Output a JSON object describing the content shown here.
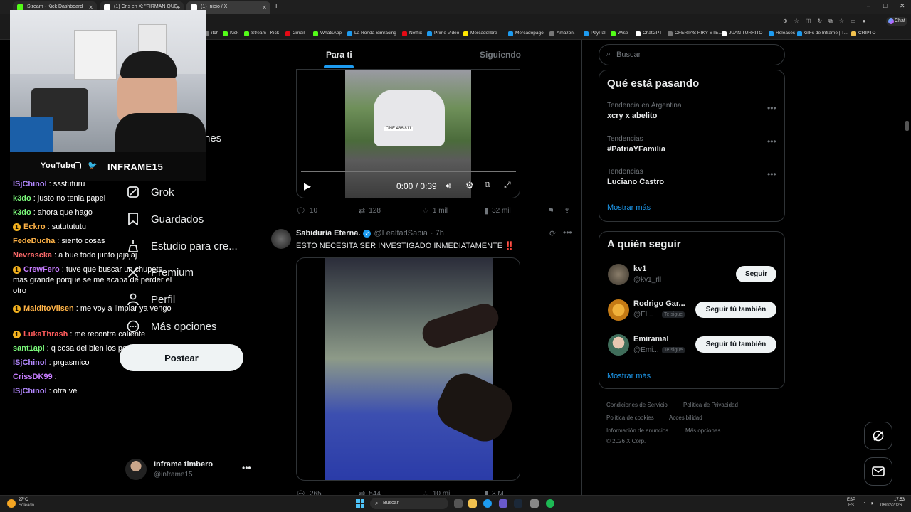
{
  "browser": {
    "tabs": [
      {
        "label": "Stream - Kick Dashboard"
      },
      {
        "label": "(1) Cris en X: \"FIRMAN QUE..."
      },
      {
        "label": "(1) Inicio / X"
      }
    ],
    "new_tab": "+",
    "window_controls": [
      "–",
      "□",
      "✕"
    ],
    "chat_label": "Chat",
    "bookmarks": [
      {
        "label": "itch",
        "cls": ""
      },
      {
        "label": "Kick",
        "cls": "kick"
      },
      {
        "label": "Stream - Kick",
        "cls": "kick"
      },
      {
        "label": "Gmail",
        "cls": "red"
      },
      {
        "label": "WhatsApp",
        "cls": "kick"
      },
      {
        "label": "La Ronda Simracing",
        "cls": "blue"
      },
      {
        "label": "Netflix",
        "cls": "red"
      },
      {
        "label": "Prime Video",
        "cls": "blue"
      },
      {
        "label": "Mercadolibre",
        "cls": "yel"
      },
      {
        "label": "Mercadopago",
        "cls": "blue"
      },
      {
        "label": "Amazon.",
        "cls": ""
      },
      {
        "label": "PayPal",
        "cls": "blue"
      },
      {
        "label": "Wise",
        "cls": "kick"
      },
      {
        "label": "ChatGPT",
        "cls": "x"
      },
      {
        "label": "OFERTAS RIKY STE...",
        "cls": ""
      },
      {
        "label": "JUAN TURRITO",
        "cls": "x"
      },
      {
        "label": "Releases",
        "cls": "blue"
      },
      {
        "label": "GIFs de Inframe | T...",
        "cls": "blue"
      },
      {
        "label": "CRIPTO",
        "cls": "folder"
      }
    ]
  },
  "stream_overlay": {
    "socials": [
      "YouTube",
      "INFRAME15"
    ],
    "chat": [
      {
        "user": "ISjChinol",
        "color": "#b388ff",
        "msg": ": ssstuturu",
        "badge": ""
      },
      {
        "user": "k3do",
        "color": "#7cfc7c",
        "msg": ": justo no tenia papel",
        "badge": ""
      },
      {
        "user": "k3do",
        "color": "#7cfc7c",
        "msg": ": ahora que hago",
        "badge": ""
      },
      {
        "user": "Eckro",
        "color": "#ffb347",
        "msg": ": sututututu",
        "badge": "1"
      },
      {
        "user": "FedeDucha",
        "color": "#ffb347",
        "msg": ": siento cosas",
        "badge": ""
      },
      {
        "user": "Nevrascka",
        "color": "#ff6b6b",
        "msg": ": a bue todo junto jajajaj",
        "badge": ""
      },
      {
        "user": "CrewFero",
        "color": "#c77dff",
        "msg": ": tuve que buscar un chupete mas grande porque se me acaba de perder el otro",
        "badge": "1"
      },
      {
        "user": "MalditoVilsen",
        "color": "#ffb347",
        "msg": ": me voy a limpiar ya vengo",
        "badge": "1"
      },
      {
        "user": "LukaThrash",
        "color": "#ff5c5c",
        "msg": ": me recontra caliente",
        "badge": "1"
      },
      {
        "user": "sant1apl",
        "color": "#7cfc7c",
        "msg": ": q cosa del bien los penjas",
        "badge": ""
      },
      {
        "user": "ISjChinol",
        "color": "#b388ff",
        "msg": ": prgasmico",
        "badge": ""
      },
      {
        "user": "CrissDK99",
        "color": "#c77dff",
        "msg": ":",
        "badge": ""
      },
      {
        "user": "ISjChinol",
        "color": "#b388ff",
        "msg": ": otra ve",
        "badge": ""
      }
    ]
  },
  "x_nav": {
    "partial": "nes",
    "items": [
      {
        "label": "Grok",
        "icon": "grok-icon"
      },
      {
        "label": "Guardados",
        "icon": "bookmark-icon"
      },
      {
        "label": "Estudio para cre...",
        "icon": "studio-icon"
      },
      {
        "label": "Premium",
        "icon": "x-premium-icon"
      },
      {
        "label": "Perfil",
        "icon": "person-icon"
      },
      {
        "label": "Más opciones",
        "icon": "more-icon"
      }
    ],
    "post_button": "Postear",
    "account": {
      "name": "Inframe timbero",
      "handle": "@inframe15"
    }
  },
  "feed": {
    "tabs": [
      "Para ti",
      "Siguiendo"
    ],
    "video1": {
      "time": "0:00 / 0:39",
      "plate": "ONE 486.811",
      "stats": {
        "replies": "10",
        "reposts": "128",
        "likes": "1 mil",
        "views": "32 mil"
      }
    },
    "post2": {
      "author": "Sabiduría Eterna.",
      "handle": "@LealtadSabia",
      "time": "· 7h",
      "text": "ESTO NECESITA SER INVESTIGADO INMEDIATAMENTE",
      "emoji": "‼️",
      "stats": {
        "replies": "265",
        "reposts": "544",
        "likes": "10 mil",
        "views": "3 M"
      }
    }
  },
  "sidebar": {
    "search_placeholder": "Buscar",
    "trends_title": "Qué está pasando",
    "trends": [
      {
        "label": "Tendencia en Argentina",
        "name": "xcry x abelito"
      },
      {
        "label": "Tendencias",
        "name": "#PatriaYFamilia"
      },
      {
        "label": "Tendencias",
        "name": "Luciano Castro"
      }
    ],
    "show_more": "Mostrar más",
    "follow_title": "A quién seguir",
    "follow": [
      {
        "name": "kv1",
        "handle": "@kv1_rll",
        "button": "Seguir",
        "follows_you": ""
      },
      {
        "name": "Rodrigo Gar...",
        "handle": "@El...",
        "button": "Seguir tú también",
        "follows_you": "Te sigue"
      },
      {
        "name": "Emiramal",
        "handle": "@Emi...",
        "button": "Seguir tú también",
        "follows_you": "Te sigue"
      }
    ],
    "show_more_2": "Mostrar más",
    "footer": {
      "links": [
        "Condiciones de Servicio",
        "Política de Privacidad",
        "Política de cookies",
        "Accesibilidad",
        "Información de anuncios",
        "Más opciones ..."
      ],
      "copyright": "© 2026 X Corp."
    }
  },
  "taskbar": {
    "weather_temp": "27°C",
    "weather_desc": "Soleado",
    "search": "Buscar",
    "lang": "ESP",
    "lang2": "ES",
    "time": "17:53",
    "date": "06/02/2026"
  },
  "colors": {
    "accent": "#1d9bf0",
    "bg": "#000000",
    "border": "#2f3336",
    "muted": "#71767b"
  }
}
